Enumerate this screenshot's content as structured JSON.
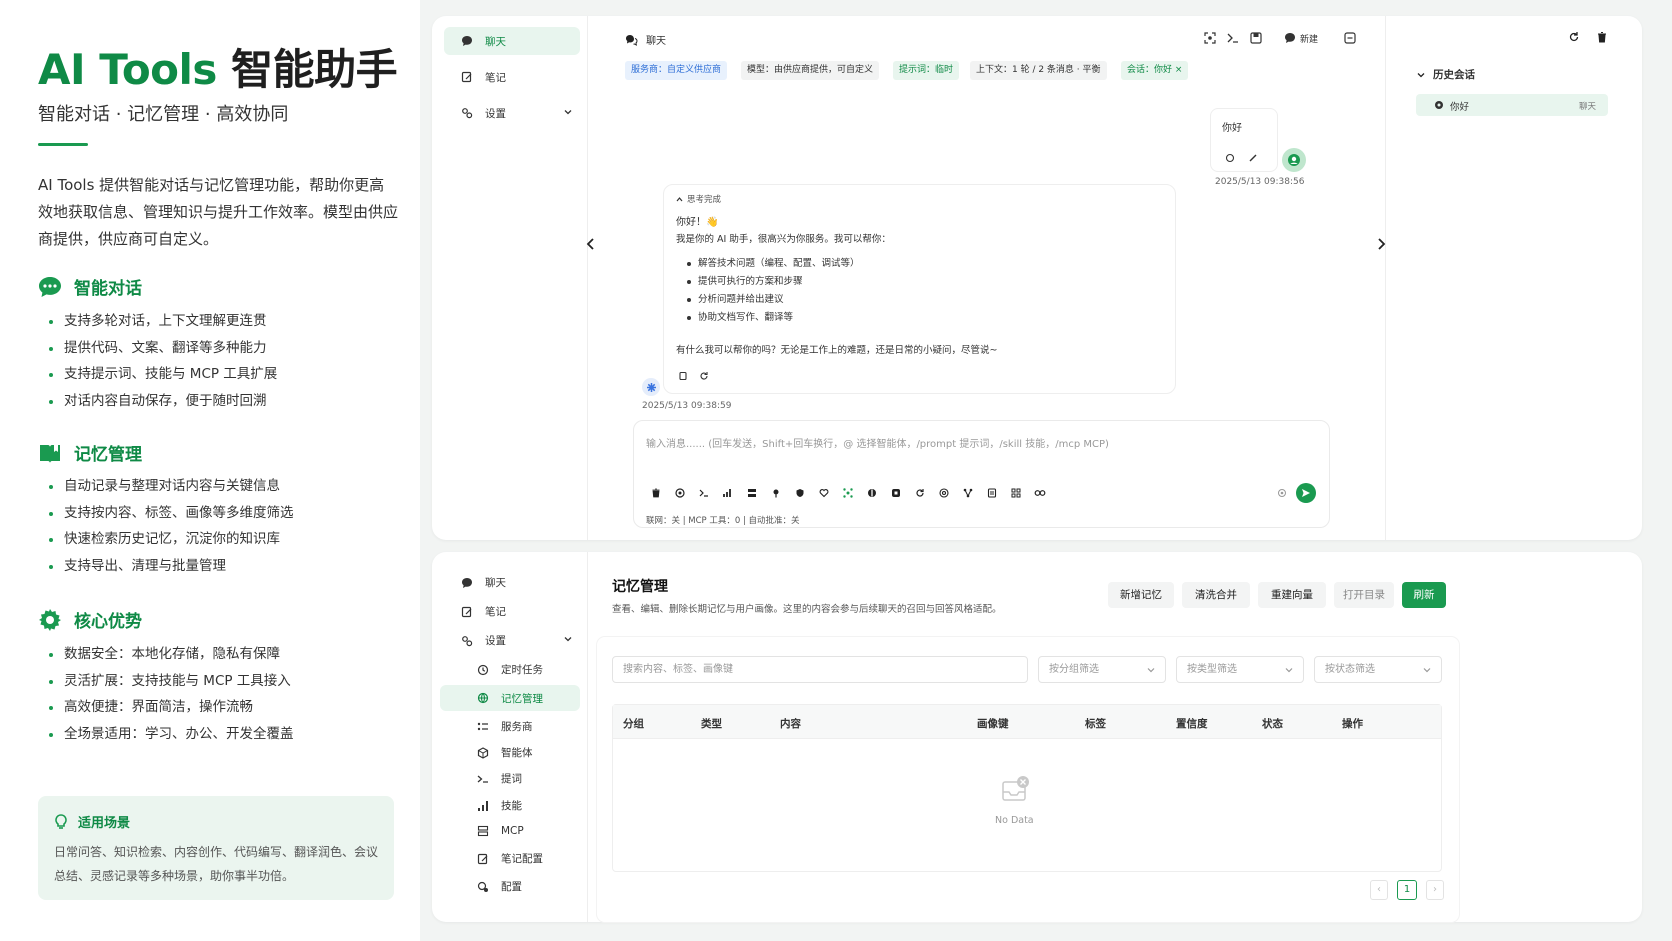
{
  "intro": {
    "title_en": "AI Tools",
    "title_cn": "智能助手",
    "subtitle": "智能对话 · 记忆管理 · 高效协同",
    "description": "AI Tools 提供智能对话与记忆管理功能，帮助你更高效地获取信息、管理知识与提升工作效率。模型由供应商提供，供应商可自定义。",
    "sections": [
      {
        "title": "智能对话",
        "items": [
          "支持多轮对话，上下文理解更连贯",
          "提供代码、文案、翻译等多种能力",
          "支持提示词、技能与 MCP 工具扩展",
          "对话内容自动保存，便于随时回溯"
        ]
      },
      {
        "title": "记忆管理",
        "items": [
          "自动记录与整理对话内容与关键信息",
          "支持按内容、标签、画像等多维度筛选",
          "快速检索历史记忆，沉淀你的知识库",
          "支持导出、清理与批量管理"
        ]
      },
      {
        "title": "核心优势",
        "items": [
          "数据安全：本地化存储，隐私有保障",
          "灵活扩展：支持技能与 MCP 工具接入",
          "高效便捷：界面简洁，操作流畅",
          "全场景适用：学习、办公、开发全覆盖"
        ]
      }
    ],
    "scene_title": "适用场景",
    "scene_text": "日常问答、知识检索、内容创作、代码编写、翻译润色、会议总结、灵感记录等多种场景，助你事半功倍。"
  },
  "chat_window": {
    "nav": {
      "chat": "聊天",
      "notes": "笔记",
      "settings": "设置"
    },
    "header_title": "聊天",
    "new_label": "新建",
    "tags": {
      "provider": "服务商：自定义供应商",
      "model": "模型：由供应商提供，可自定义",
      "prompt": "提示词：临时",
      "context": "上下文：1 轮 / 2 条消息 · 平衡",
      "session": "会话：你好",
      "session_close": "×"
    },
    "user_msg": {
      "text": "你好",
      "time": "2025/5/13 09:38:56"
    },
    "ai_msg": {
      "thinking": "思考完成",
      "greeting": "你好！👋",
      "intro": "我是你的 AI 助手，很高兴为你服务。我可以帮你：",
      "items": [
        "解答技术问题（编程、配置、调试等）",
        "提供可执行的方案和步骤",
        "分析问题并给出建议",
        "协助文档写作、翻译等"
      ],
      "closing": "有什么我可以帮你的吗？无论是工作上的难题，还是日常的小疑问，尽管说~",
      "time": "2025/5/13 09:38:59"
    },
    "input_placeholder": "输入消息...... (回车发送，Shift+回车换行，@ 选择智能体，/prompt 提示词，/skill 技能，/mcp MCP)",
    "status_line": "联网：关 | MCP 工具：0 | 自动批准：关",
    "history": {
      "title": "历史会话",
      "items": [
        {
          "title": "你好",
          "type": "聊天"
        }
      ]
    }
  },
  "memory_window": {
    "nav": {
      "chat": "聊天",
      "notes": "笔记",
      "settings": "设置",
      "scheduled": "定时任务",
      "memory": "记忆管理",
      "provider": "服务商",
      "agent": "智能体",
      "prompt": "提词",
      "skill": "技能",
      "mcp": "MCP",
      "note_config": "笔记配置",
      "config": "配置"
    },
    "title": "记忆管理",
    "description": "查看、编辑、删除长期记忆与用户画像。这里的内容会参与后续聊天的召回与回答风格适配。",
    "buttons": {
      "add": "新增记忆",
      "clean": "清洗合并",
      "rebuild": "重建向量",
      "open_dir": "打开目录",
      "refresh": "刷新"
    },
    "search_placeholder": "搜索内容、标签、画像键",
    "filters": {
      "group": "按分组筛选",
      "type": "按类型筛选",
      "status": "按状态筛选"
    },
    "columns": [
      "分组",
      "类型",
      "内容",
      "画像键",
      "标签",
      "置信度",
      "状态",
      "操作"
    ],
    "empty_text": "No Data",
    "pagination": {
      "current": "1",
      "prev": "‹",
      "next": "›"
    }
  },
  "colors": {
    "brand": "#0f8a46",
    "accent": "#1a9a50",
    "light": "#e8f5ee",
    "blue_tag": "#e8f1fd"
  }
}
